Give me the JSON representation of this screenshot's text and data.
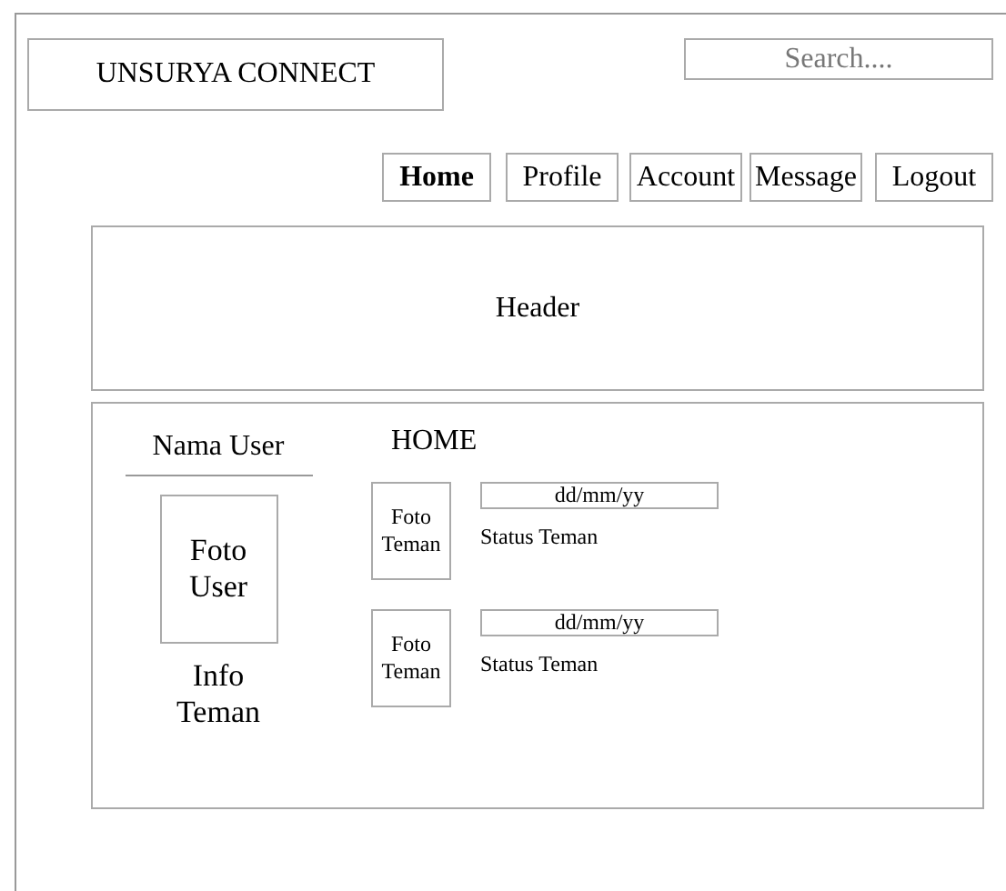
{
  "logo": "UNSURYA CONNECT",
  "search": {
    "placeholder": "Search...."
  },
  "nav": [
    {
      "label": "Home",
      "selected": true
    },
    {
      "label": "Profile",
      "selected": false
    },
    {
      "label": "Account",
      "selected": false
    },
    {
      "label": "Message",
      "selected": false
    },
    {
      "label": "Logout",
      "selected": false
    }
  ],
  "header": "Header",
  "sidebar": {
    "user_name": "Nama User",
    "photo": "Foto User",
    "info": "Info Teman"
  },
  "main": {
    "title": "HOME",
    "posts": [
      {
        "photo": "Foto Teman",
        "date": "dd/mm/yy",
        "status": "Status Teman"
      },
      {
        "photo": "Foto Teman",
        "date": "dd/mm/yy",
        "status": "Status Teman"
      }
    ]
  }
}
